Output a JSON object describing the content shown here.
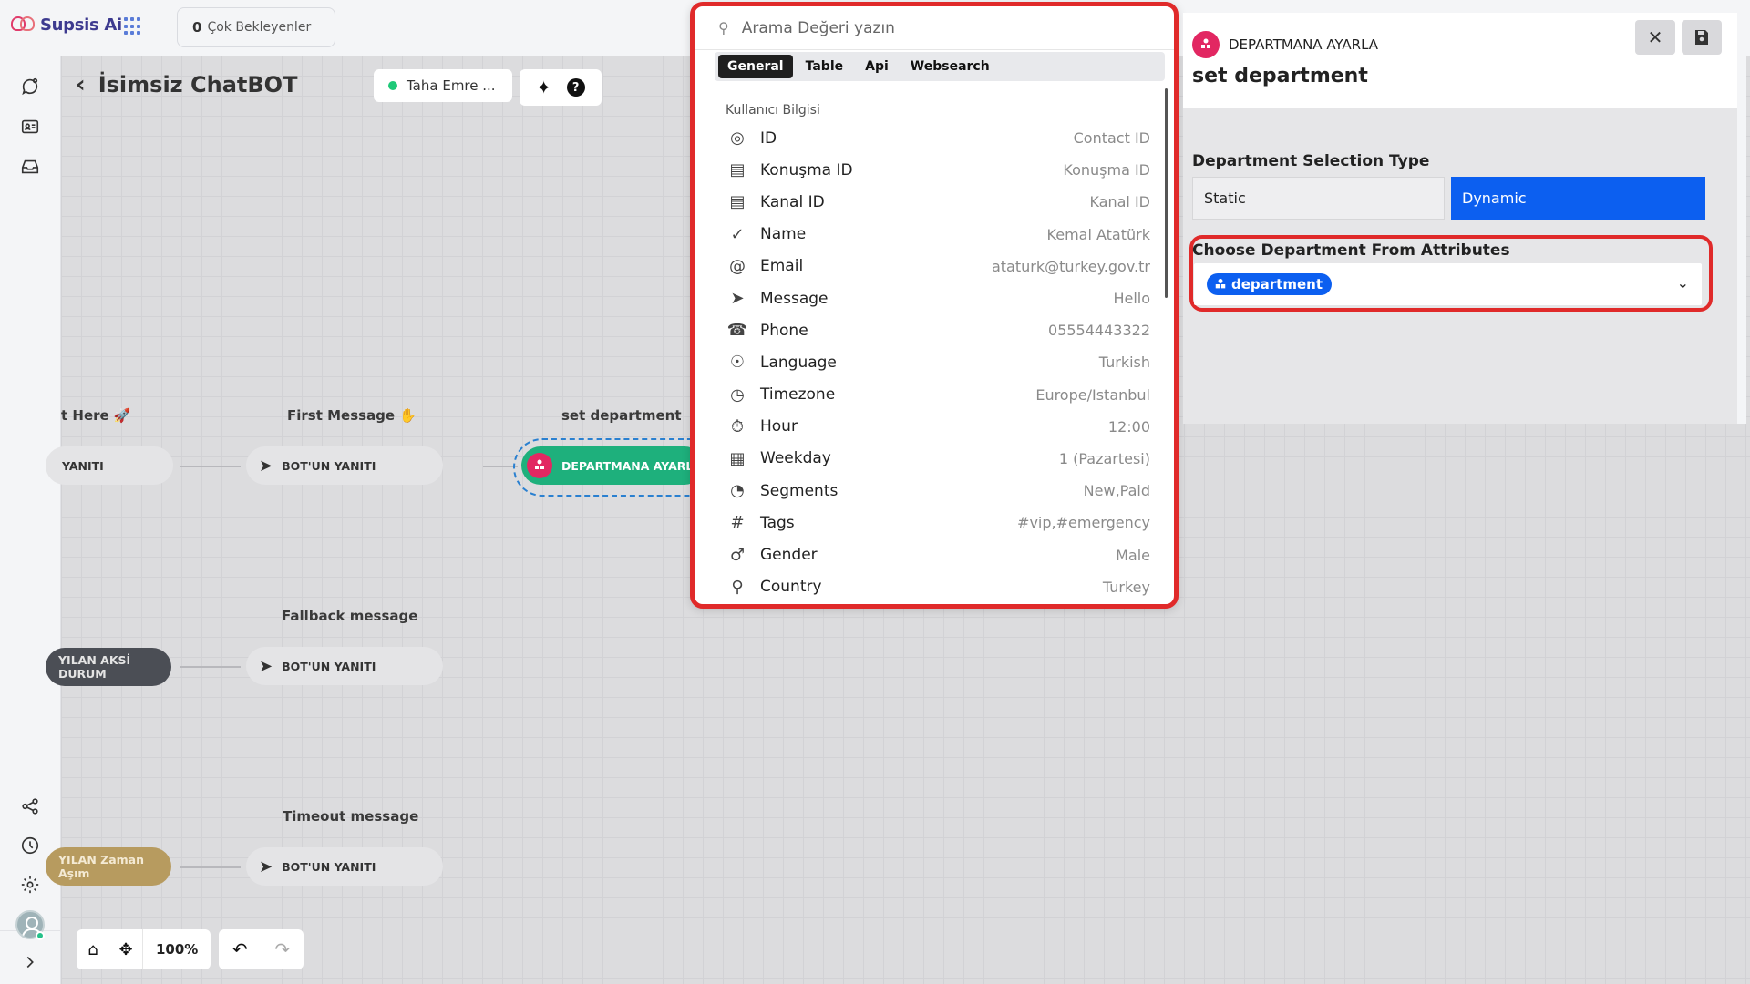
{
  "app": {
    "brand": "Supsis Ai",
    "brand_color": "#3d3a8f",
    "accent_color": "#0c5ff0"
  },
  "topbar": {
    "waiting_count": "0",
    "waiting_label": "Çok Bekleyenler"
  },
  "sidebar": {
    "icons": [
      "chat-icon",
      "contacts-icon",
      "inbox-icon",
      "share-icon",
      "clock-icon",
      "settings-icon",
      "avatar",
      "chevron-right-icon"
    ]
  },
  "canvas": {
    "bot_title": "İsimsiz ChatBOT",
    "user_name": "Taha Emre ...",
    "zoom": "100%",
    "labels": {
      "start_here": "t Here 🚀",
      "first_message": "First Message ✋",
      "set_department": "set department",
      "fallback": "Fallback message",
      "timeout": "Timeout message"
    },
    "nodes": {
      "n1": "YANITI",
      "n2": "BOT'UN YANITI",
      "n3": "DEPARTMANA AYARLA",
      "n4": "YILAN AKSİ DURUM",
      "n5": "BOT'UN YANITI",
      "n6": "YILAN Zaman Aşım",
      "n7": "BOT'UN YANITI"
    }
  },
  "attr_popup": {
    "search_placeholder": "Arama Değeri yazın",
    "tabs": [
      "General",
      "Table",
      "Api",
      "Websearch"
    ],
    "active_tab": "General",
    "section": "Kullanıcı Bilgisi",
    "items": [
      {
        "icon": "fingerprint-icon",
        "name": "ID",
        "value": "Contact ID"
      },
      {
        "icon": "message-icon",
        "name": "Konuşma ID",
        "value": "Konuşma ID"
      },
      {
        "icon": "message-icon",
        "name": "Kanal ID",
        "value": "Kanal ID"
      },
      {
        "icon": "check-icon",
        "name": "Name",
        "value": "Kemal Atatürk"
      },
      {
        "icon": "at-icon",
        "name": "Email",
        "value": "ataturk@turkey.gov.tr"
      },
      {
        "icon": "send-icon",
        "name": "Message",
        "value": "Hello"
      },
      {
        "icon": "phone-icon",
        "name": "Phone",
        "value": "05554443322"
      },
      {
        "icon": "globe-icon",
        "name": "Language",
        "value": "Turkish"
      },
      {
        "icon": "clock-icon",
        "name": "Timezone",
        "value": "Europe/Istanbul"
      },
      {
        "icon": "timer-icon",
        "name": "Hour",
        "value": "12:00"
      },
      {
        "icon": "calendar-icon",
        "name": "Weekday",
        "value": "1 (Pazartesi)"
      },
      {
        "icon": "pie-chart-icon",
        "name": "Segments",
        "value": "New,Paid"
      },
      {
        "icon": "hashtag-icon",
        "name": "Tags",
        "value": "#vip,#emergency"
      },
      {
        "icon": "male-icon",
        "name": "Gender",
        "value": "Male"
      },
      {
        "icon": "location-pin-icon",
        "name": "Country",
        "value": "Turkey"
      }
    ]
  },
  "panel": {
    "type": "DEPARTMANA AYARLA",
    "title": "set department",
    "selection_type_label": "Department Selection Type",
    "static_label": "Static",
    "dynamic_label": "Dynamic",
    "selected_type": "Dynamic",
    "attribute_label": "Choose Department From Attributes",
    "attribute_value": "department"
  }
}
